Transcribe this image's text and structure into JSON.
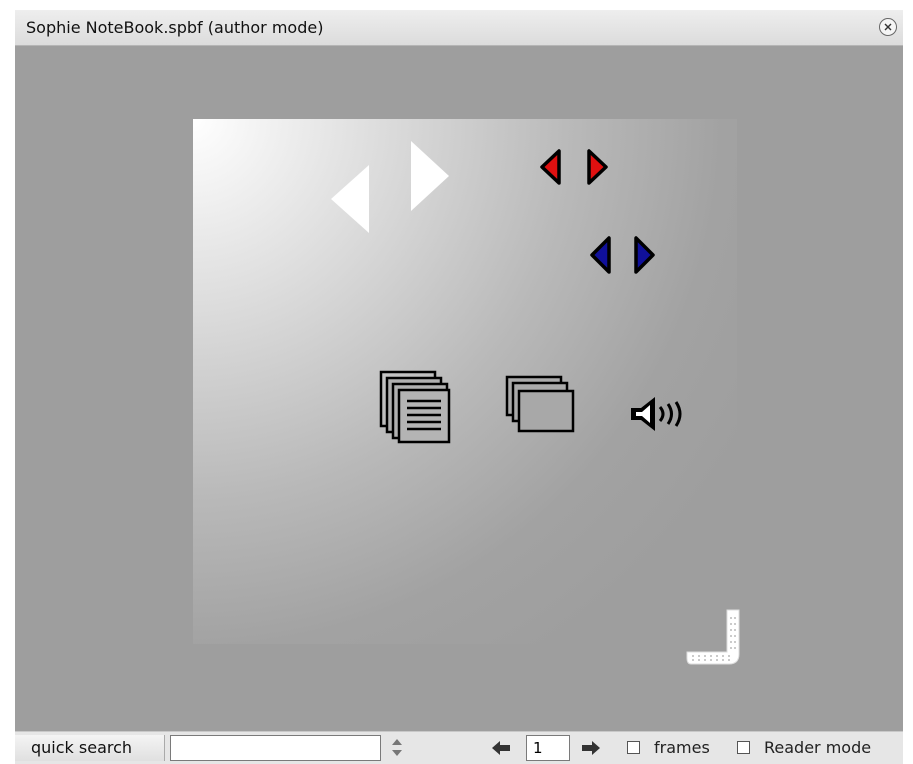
{
  "window": {
    "title": "Sophie NoteBook.spbf (author mode)"
  },
  "canvas": {
    "page_background": "radial gradient white to #9e9e9e",
    "icons": [
      "prev-page-white-arrow-icon",
      "next-page-white-arrow-icon",
      "prev-red-arrow-icon",
      "next-red-arrow-icon",
      "prev-blue-arrow-icon",
      "next-blue-arrow-icon",
      "document-stack-icon",
      "frames-stack-icon",
      "speaker-icon",
      "resize-corner-handle"
    ]
  },
  "statusbar": {
    "quick_search_label": "quick search",
    "search_value": "",
    "page_number": "1",
    "frames_label": "frames",
    "frames_checked": false,
    "reader_mode_label": "Reader mode",
    "reader_mode_checked": false
  },
  "colors": {
    "workspace": "#9e9e9e",
    "red_arrow": "#e01010",
    "blue_arrow": "#10109a"
  }
}
